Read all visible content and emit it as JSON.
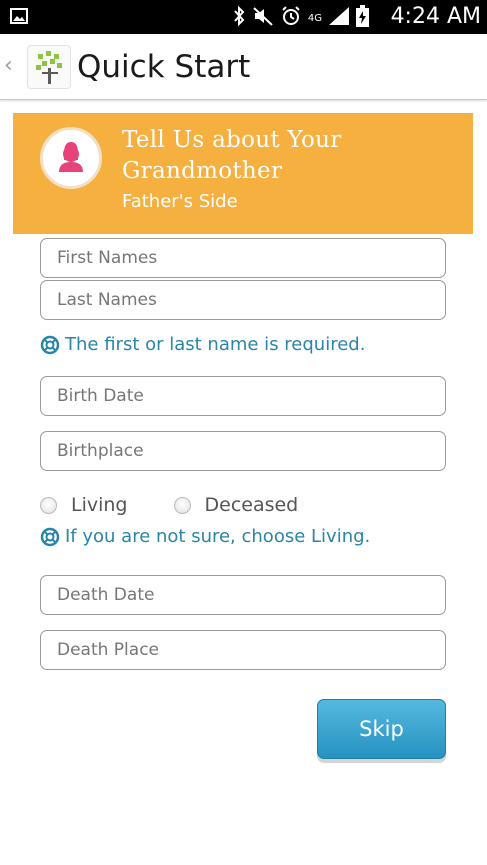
{
  "status_bar": {
    "time": "4:24 AM",
    "network": "4G",
    "icons": [
      "image-icon",
      "bluetooth-icon",
      "mute-icon",
      "alarm-icon",
      "signal-icon",
      "battery-icon"
    ]
  },
  "action_bar": {
    "title": "Quick Start",
    "back_icon": "chevron-left-icon",
    "logo_icon": "family-tree-icon"
  },
  "banner": {
    "heading": "Tell Us about Your Grandmother",
    "subheading": "Father's Side",
    "avatar_icon": "female-person-icon",
    "background_color": "#f6b040",
    "avatar_color": "#e5437a"
  },
  "form": {
    "first_names_placeholder": "First Names",
    "last_names_placeholder": "Last Names",
    "name_hint": "The first or last name is required.",
    "birth_date_placeholder": "Birth Date",
    "birthplace_placeholder": "Birthplace",
    "status_options": [
      "Living",
      "Deceased"
    ],
    "status_hint": "If you are not sure, choose Living.",
    "death_date_placeholder": "Death Date",
    "death_place_placeholder": "Death Place",
    "hint_icon": "lifebuoy-icon",
    "hint_color": "#2a85a8"
  },
  "actions": {
    "skip_label": "Skip",
    "accent_color": "#2592c0"
  }
}
